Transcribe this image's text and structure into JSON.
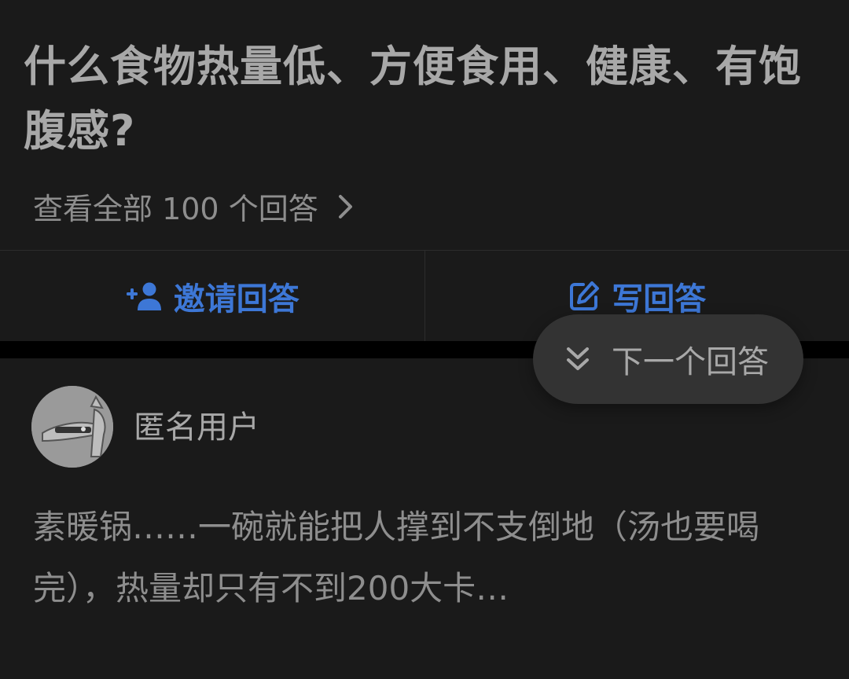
{
  "question": {
    "title": "什么食物热量低、方便食用、健康、有饱腹感?",
    "view_all_label": "查看全部 100 个回答"
  },
  "actions": {
    "invite_label": "邀请回答",
    "write_label": "写回答"
  },
  "answer": {
    "author": "匿名用户",
    "excerpt": "素暖锅……一碗就能把人撑到不支倒地（汤也要喝完），热量却只有不到200大卡…"
  },
  "floating": {
    "next_label": "下一个回答"
  },
  "colors": {
    "background": "#1a1a1a",
    "accent_blue": "#3d77d6",
    "pill_bg": "#333333"
  },
  "icons": {
    "view_all": "chevron-right-icon",
    "invite": "add-person-icon",
    "write": "edit-square-icon",
    "next": "double-chevron-down-icon",
    "avatar": "anonymous-user-avatar"
  }
}
